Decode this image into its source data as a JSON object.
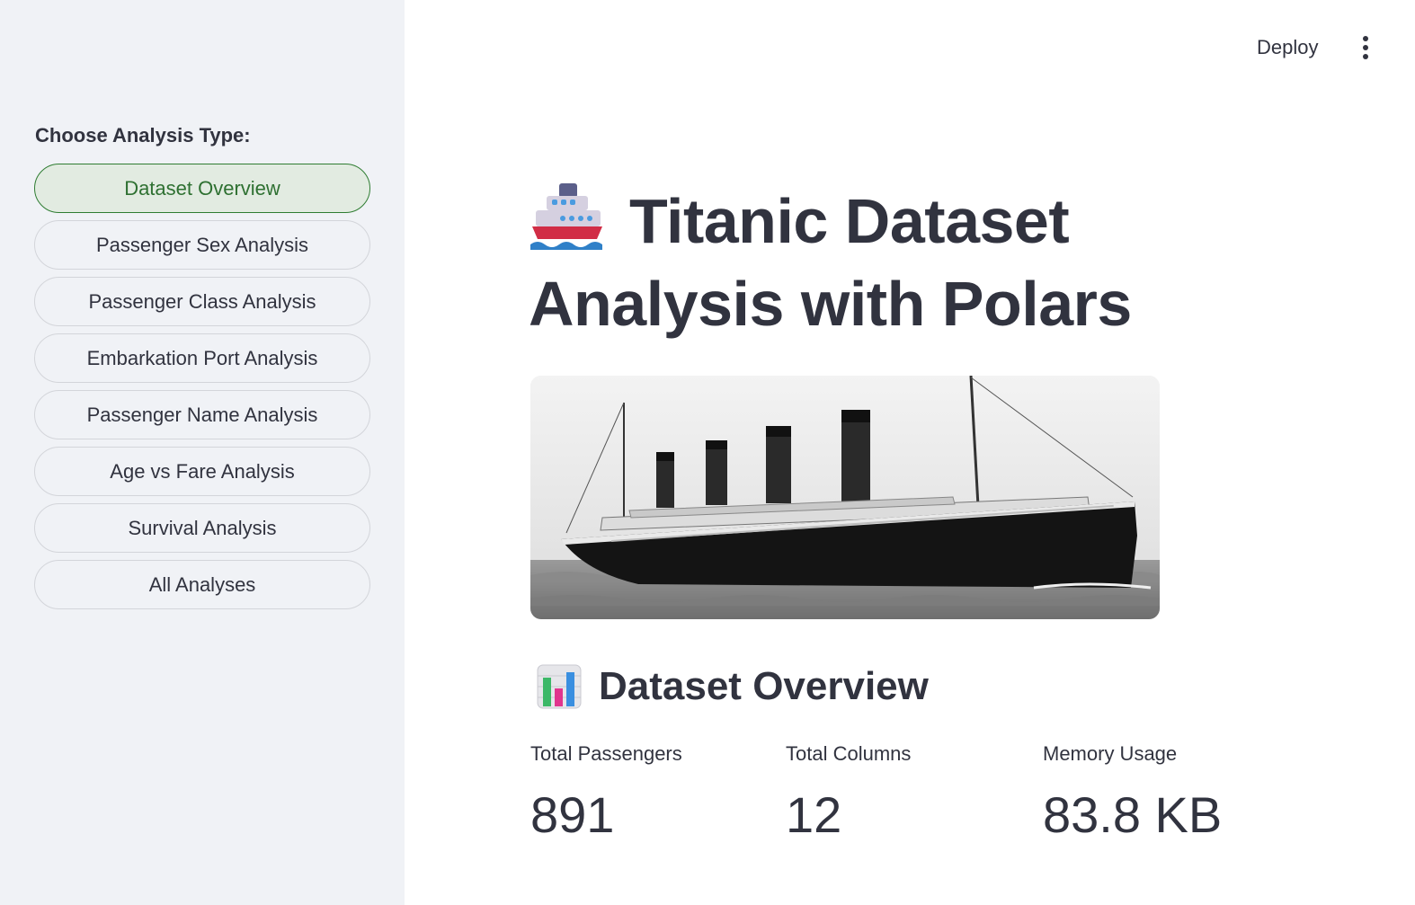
{
  "sidebar": {
    "heading": "Choose Analysis Type:",
    "options": [
      {
        "label": "Dataset Overview",
        "active": true
      },
      {
        "label": "Passenger Sex Analysis",
        "active": false
      },
      {
        "label": "Passenger Class Analysis",
        "active": false
      },
      {
        "label": "Embarkation Port Analysis",
        "active": false
      },
      {
        "label": "Passenger Name Analysis",
        "active": false
      },
      {
        "label": "Age vs Fare Analysis",
        "active": false
      },
      {
        "label": "Survival Analysis",
        "active": false
      },
      {
        "label": "All Analyses",
        "active": false
      }
    ]
  },
  "header": {
    "deploy_label": "Deploy",
    "menu_icon": "vertical-ellipsis-icon"
  },
  "main": {
    "title": "Titanic Dataset Analysis with Polars",
    "title_icon": "ship-icon",
    "hero_image": "titanic-ship-photo",
    "section_title": "Dataset Overview",
    "section_icon": "bar-chart-icon",
    "metrics": [
      {
        "label": "Total Passengers",
        "value": "891"
      },
      {
        "label": "Total Columns",
        "value": "12"
      },
      {
        "label": "Memory Usage",
        "value": "83.8 KB"
      }
    ]
  },
  "colors": {
    "sidebar_bg": "#f0f2f6",
    "active_bg": "#e2ebe1",
    "active_border": "#2f7d32",
    "active_text": "#2e7031",
    "text": "#31333f"
  }
}
